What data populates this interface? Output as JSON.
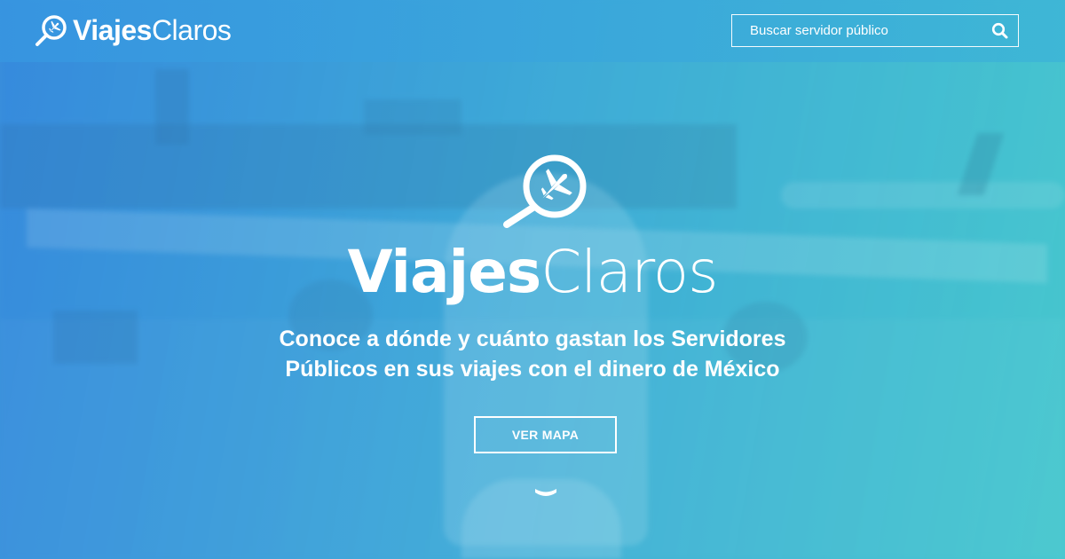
{
  "header": {
    "brand_strong": "Viajes",
    "brand_light": "Claros",
    "logo_icon": "magnifier-airplane-icon"
  },
  "search": {
    "placeholder": "Buscar servidor público",
    "icon": "search-icon"
  },
  "hero": {
    "brand_strong": "Viajes",
    "brand_light": "Claros",
    "logo_icon": "magnifier-airplane-icon",
    "tagline_line1": "Conoce a dónde y cuánto gastan los Servidores",
    "tagline_line2": "Públicos en sus viajes con el dinero de México",
    "button_label": "VER MAPA",
    "scroll_icon": "chevron-down-icon"
  },
  "colors": {
    "gradient_start": "#3a8fdd",
    "gradient_end": "#48c6cf",
    "text": "#ffffff"
  }
}
